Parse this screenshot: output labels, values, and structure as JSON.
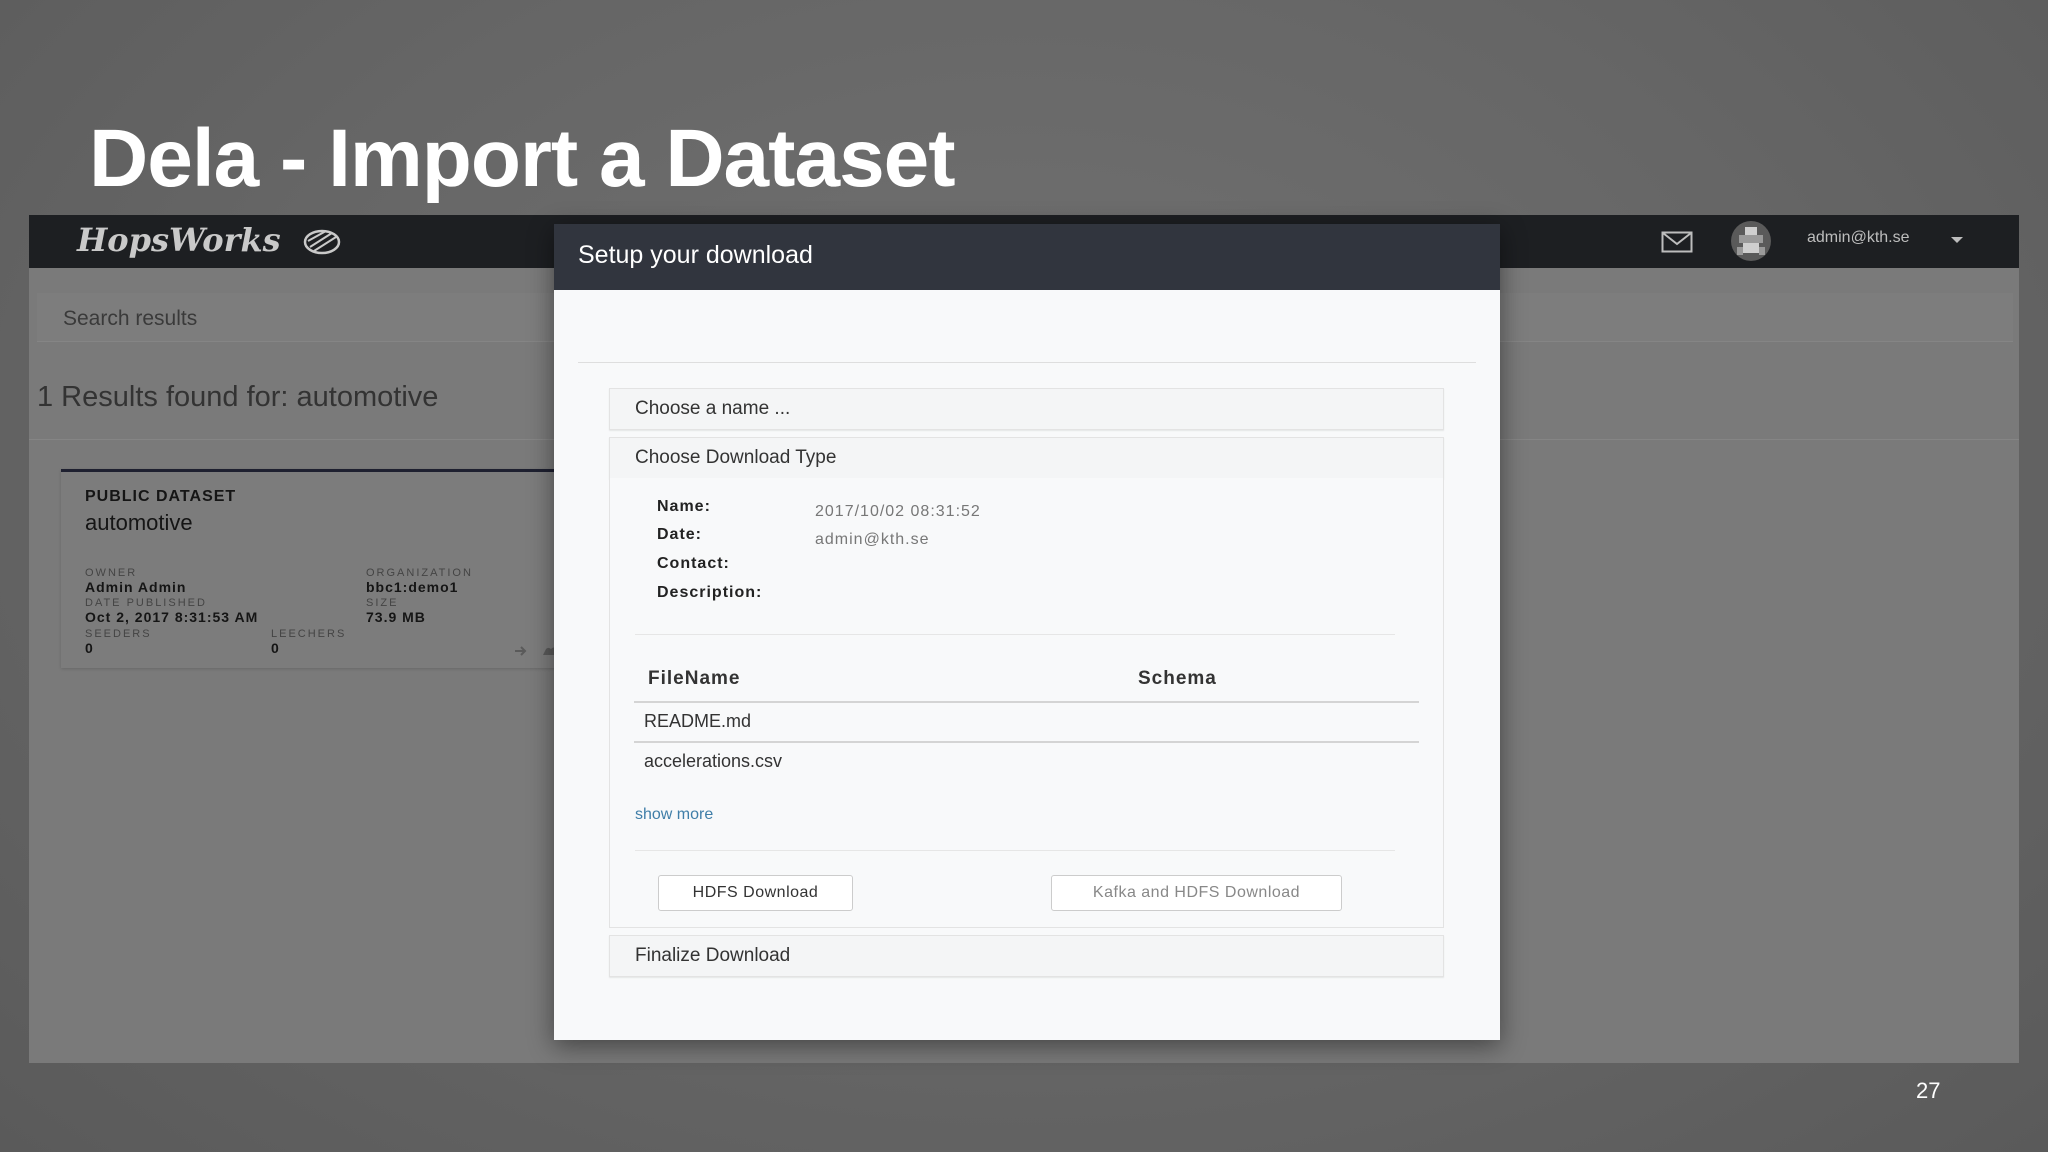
{
  "slide": {
    "title": "Dela - Import a Dataset",
    "page_number": "27"
  },
  "app": {
    "brand": "HopsWorks",
    "user_email": "admin@kth.se",
    "search_label": "Search results",
    "results_header": "1 Results found for: automotive",
    "card": {
      "type": "PUBLIC DATASET",
      "name": "automotive",
      "owner_label": "OWNER",
      "owner": "Admin Admin",
      "org_label": "ORGANIZATION",
      "org": "bbc1:demo1",
      "date_label": "DATE PUBLISHED",
      "date": "Oct 2, 2017 8:31:53 AM",
      "size_label": "SIZE",
      "size": "73.9 MB",
      "seeders_label": "SEEDERS",
      "seeders": "0",
      "leechers_label": "LEECHERS",
      "leechers": "0"
    }
  },
  "modal": {
    "title": "Setup your download",
    "panel_name": "Choose a name ...",
    "panel_type": "Choose Download Type",
    "panel_finalize": "Finalize Download",
    "info": {
      "name_label": "Name:",
      "date_label": "Date:",
      "contact_label": "Contact:",
      "description_label": "Description:",
      "value_1": "2017/10/02 08:31:52",
      "value_2": "admin@kth.se"
    },
    "table": {
      "headers": [
        "FileName",
        "Schema"
      ],
      "rows": [
        "README.md",
        "accelerations.csv"
      ]
    },
    "show_more": "show more",
    "buttons": {
      "hdfs": "HDFS Download",
      "kafka": "Kafka and HDFS Download"
    }
  }
}
